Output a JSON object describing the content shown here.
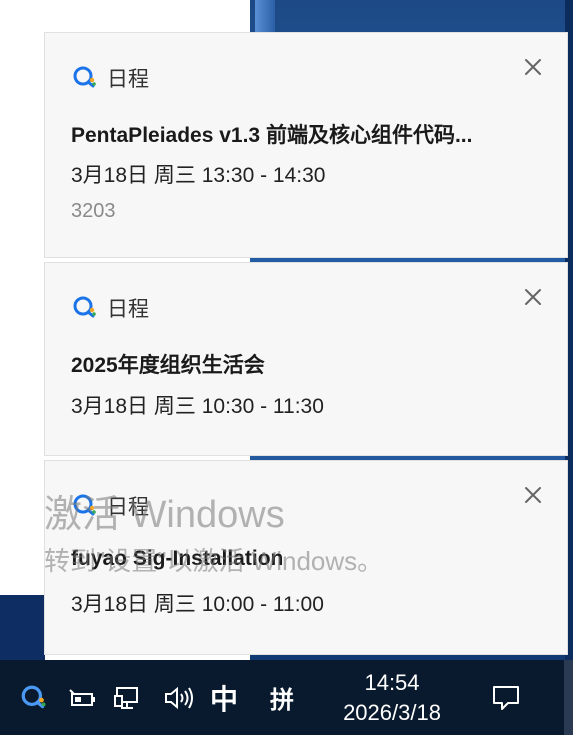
{
  "notifications": [
    {
      "app": "日程",
      "title": "PentaPleiades v1.3 前端及核心组件代码...",
      "time": "3月18日 周三 13:30 - 14:30",
      "location": "3203"
    },
    {
      "app": "日程",
      "title": "2025年度组织生活会",
      "time": "3月18日 周三 10:30 - 11:30"
    },
    {
      "app": "日程",
      "title": "fuyao Sig-Installation",
      "time": "3月18日 周三 10:00 - 11:00"
    }
  ],
  "watermark": {
    "line1": "激活 Windows",
    "line2": "转到\"设置\"以激活 Windows。"
  },
  "taskbar": {
    "ime_mode": "中",
    "ime_pinyin": "拼",
    "time": "14:54",
    "date": "2026/3/18"
  },
  "colors": {
    "wecom_blue": "#1a73e8",
    "wecom_accent": "#f5a623",
    "taskbar_bg": "#0a1a2e",
    "card_bg": "#f7f7f7"
  },
  "icons": {
    "app": "wecom-schedule-icon",
    "close": "close-icon",
    "tray": [
      "wecom-icon",
      "battery-icon",
      "network-icon",
      "volume-icon",
      "notification-icon"
    ]
  }
}
